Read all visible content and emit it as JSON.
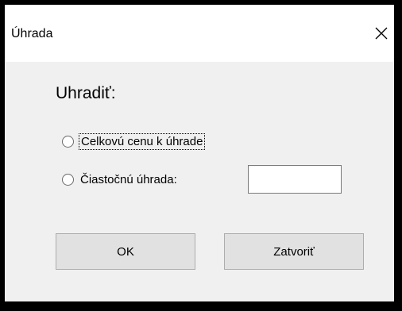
{
  "window": {
    "title": "Úhrada",
    "close_glyph": "✕",
    "close_icon": "close-icon"
  },
  "form": {
    "heading": "Uhradiť:",
    "options": [
      {
        "label": "Celkovú cenu k úhrade",
        "selected": false,
        "focused": true
      },
      {
        "label": "Čiastočnú úhrada:",
        "selected": false,
        "focused": false
      }
    ],
    "partial_amount": {
      "value": "",
      "placeholder": ""
    }
  },
  "buttons": {
    "ok_label": "OK",
    "close_label": "Zatvoriť"
  },
  "colors": {
    "titlebar": "#ffffff",
    "client": "#f0f0f0",
    "button_face": "#e1e1e1",
    "button_border": "#adadad"
  }
}
